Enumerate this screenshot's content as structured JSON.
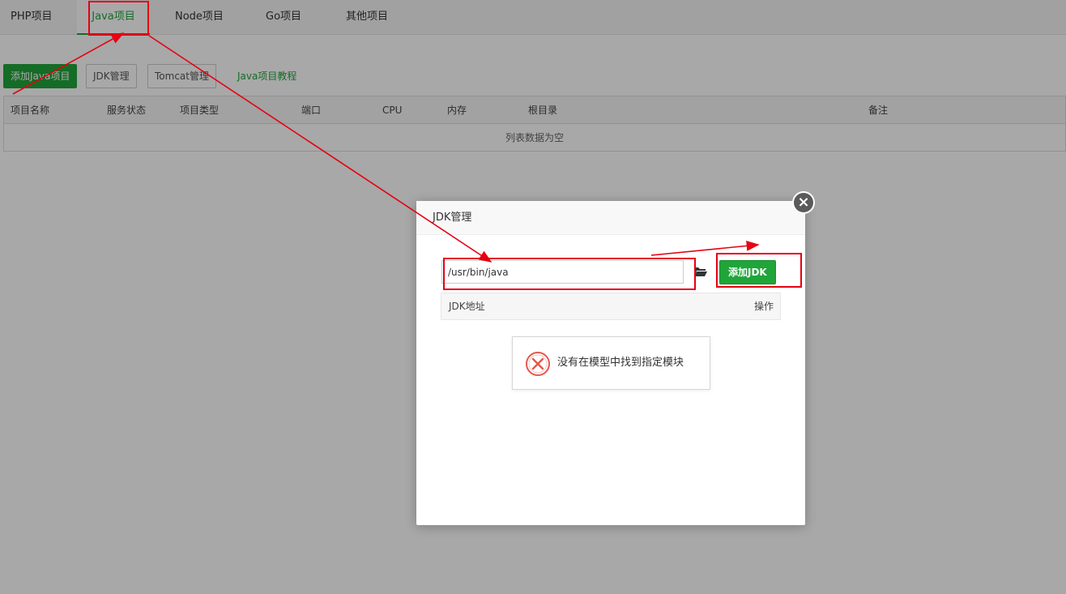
{
  "tabs": [
    {
      "label": "PHP项目"
    },
    {
      "label": "Java项目",
      "active": true
    },
    {
      "label": "Node项目"
    },
    {
      "label": "Go项目"
    },
    {
      "label": "其他项目"
    }
  ],
  "toolbar": {
    "add_label": "添加Java项目",
    "jdk_label": "JDK管理",
    "tomcat_label": "Tomcat管理",
    "tutorial_label": "Java项目教程"
  },
  "table": {
    "headers": [
      "项目名称",
      "服务状态",
      "项目类型",
      "端口",
      "CPU",
      "内存",
      "根目录",
      "备注"
    ],
    "empty_text": "列表数据为空"
  },
  "modal": {
    "title": "JDK管理",
    "path_value": "/usr/bin/java",
    "add_button": "添加JDK",
    "col_path": "JDK地址",
    "col_action": "操作",
    "close_icon": "close-icon",
    "folder_icon": "folder-open-icon"
  },
  "toast": {
    "message": "没有在模型中找到指定模块",
    "icon": "error-circle-icon"
  },
  "colors": {
    "accent": "#20a53a",
    "annotation": "#e60012",
    "error": "#e5574b"
  }
}
